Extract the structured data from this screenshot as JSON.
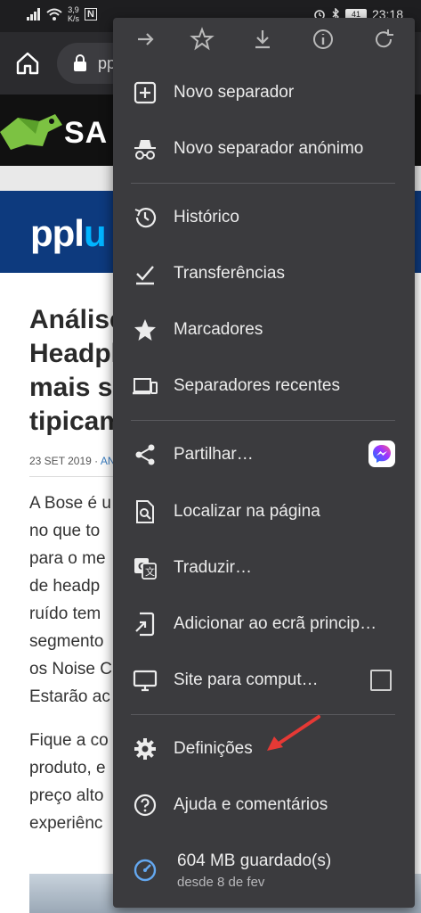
{
  "status_bar": {
    "net_speed_value": "3,9",
    "net_speed_unit": "K/s",
    "nfc_glyph": "N",
    "battery": "41",
    "time": "23:18"
  },
  "toolbar": {
    "url_partial": "pp"
  },
  "website": {
    "header_logo_text": "SA",
    "banner_brand": "ppl",
    "banner_brand_accent": "u",
    "article_title_lines": [
      "Análise",
      "Headph",
      "mais si",
      "tipicam"
    ],
    "meta_date": "23 SET 2019 · ",
    "meta_author": "AN",
    "paragraph1_lines": [
      "A Bose é u",
      "no que to",
      "para o me",
      "de headp",
      "ruído tem",
      "segmento",
      "os Noise C",
      "Estarão ac"
    ],
    "paragraph2_lines": [
      "Fique a co",
      "produto, e",
      "preço alto",
      "experiênc"
    ]
  },
  "menu": {
    "top_icons": [
      "forward-icon",
      "bookmark-star-icon",
      "download-icon",
      "info-icon",
      "refresh-icon"
    ],
    "items": [
      {
        "label": "Novo separador",
        "icon": "new-tab-icon"
      },
      {
        "label": "Novo separador anónimo",
        "icon": "incognito-icon"
      },
      {
        "label": "Histórico",
        "icon": "history-icon"
      },
      {
        "label": "Transferências",
        "icon": "downloads-icon"
      },
      {
        "label": "Marcadores",
        "icon": "star-icon"
      },
      {
        "label": "Separadores recentes",
        "icon": "devices-icon"
      },
      {
        "label": "Partilhar…",
        "icon": "share-icon"
      },
      {
        "label": "Localizar na página",
        "icon": "find-in-page-icon"
      },
      {
        "label": "Traduzir…",
        "icon": "translate-icon"
      },
      {
        "label": "Adicionar ao ecrã princip…",
        "icon": "add-to-home-icon"
      },
      {
        "label": "Site para comput…",
        "icon": "desktop-icon"
      },
      {
        "label": "Definições",
        "icon": "settings-icon"
      },
      {
        "label": "Ajuda e comentários",
        "icon": "help-icon"
      }
    ],
    "storage": {
      "title": "604 MB guardado(s)",
      "subtitle": "desde 8 de fev",
      "icon": "data-saver-icon"
    },
    "desktop_site_checked": false
  },
  "colors": {
    "menu_bg": "#3b3b3e",
    "accent_arrow": "#e53935",
    "banner_blue": "#0d3a7e",
    "brand_accent": "#00b4ff"
  }
}
